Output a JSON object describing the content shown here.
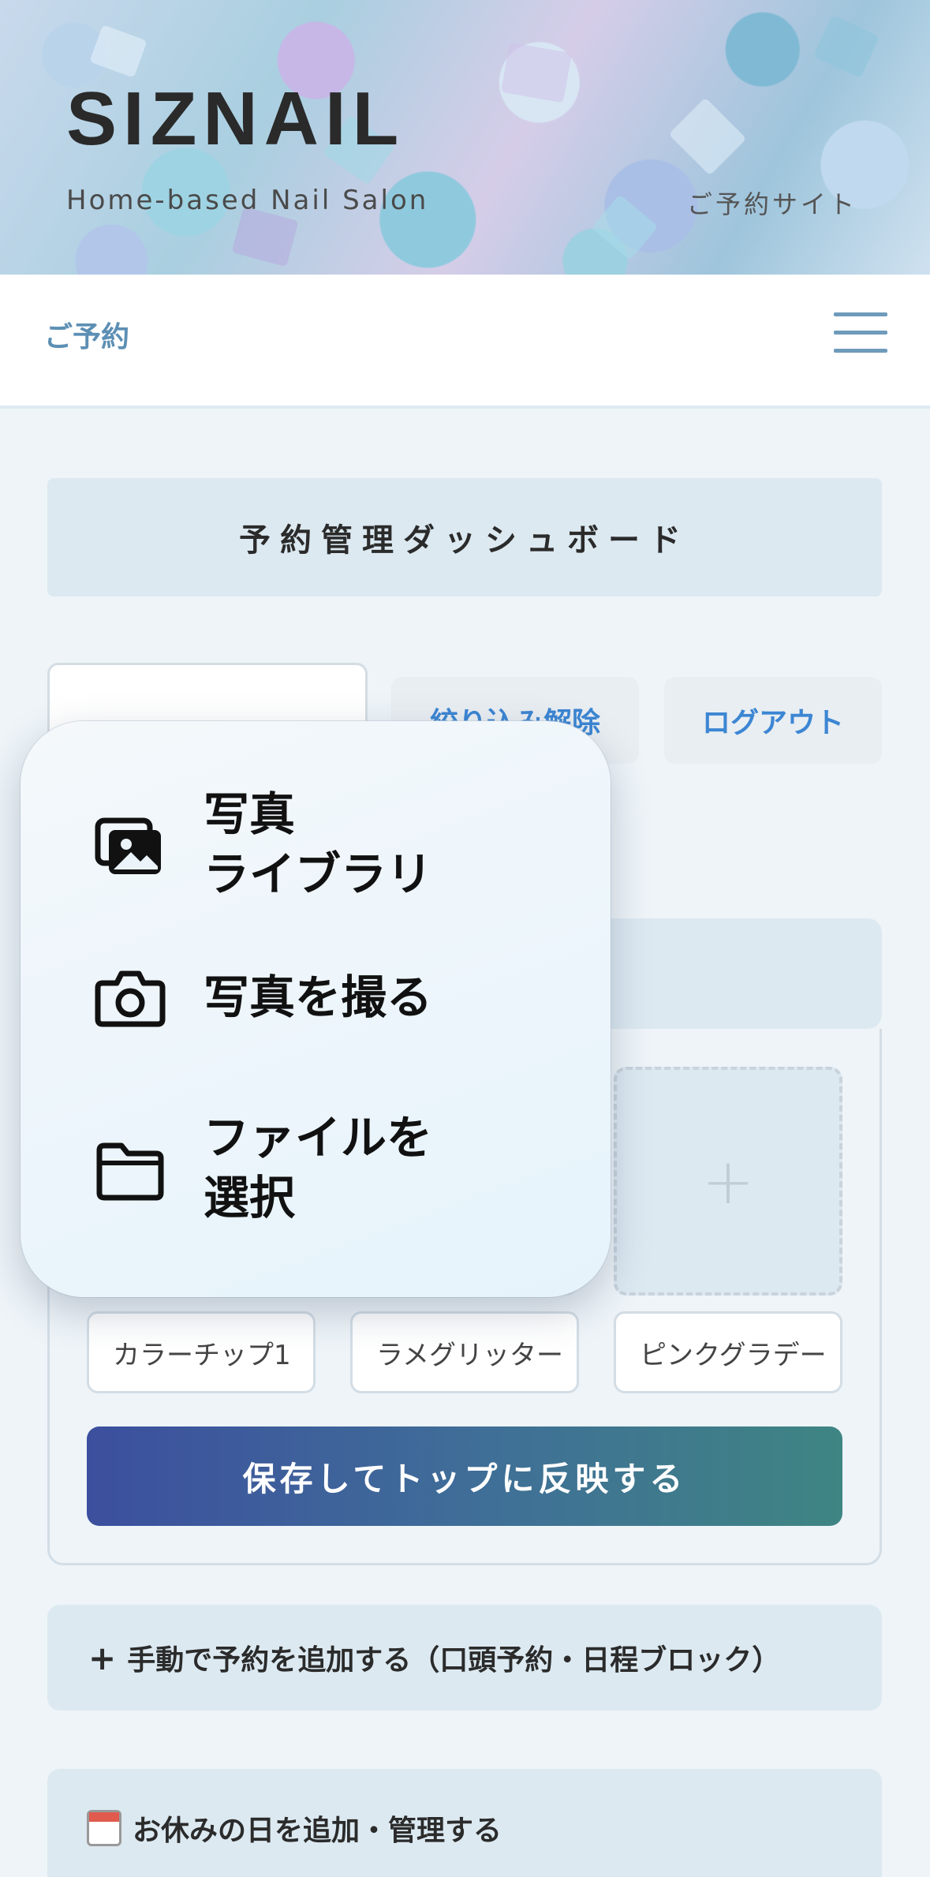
{
  "hero": {
    "title": "SIZNAIL",
    "subtitle": "Home-based Nail Salon",
    "right_label": "ご予約サイト"
  },
  "nav": {
    "label": "ご予約",
    "menu_icon": "hamburger-icon"
  },
  "dashboard": {
    "title": "予約管理ダッシュボード",
    "clear_filter": "絞り込み解除",
    "logout": "ログアウト"
  },
  "gallery": {
    "add_tile_symbol": "+",
    "names": [
      "カラーチップ1",
      "ラメグリッター",
      "ピンクグラデー"
    ],
    "save_button": "保存してトップに反映する"
  },
  "actions": {
    "manual_add_symbol": "+",
    "manual_add": "手動で予約を追加する（口頭予約・日程ブロック）",
    "holiday_icon": "calendar-icon",
    "holiday": "お休みの日を追加・管理する"
  },
  "popover": {
    "items": [
      {
        "label": "写真\nライブラリ",
        "icon": "photo-library-icon"
      },
      {
        "label": "写真を撮る",
        "icon": "camera-icon"
      },
      {
        "label": "ファイルを\n選択",
        "icon": "folder-icon"
      }
    ]
  },
  "colors": {
    "accent_blue": "#3c86d3",
    "nav_label": "#5d8fb4",
    "save_gradient_start": "#3c4f9e",
    "save_gradient_end": "#3f8583"
  }
}
